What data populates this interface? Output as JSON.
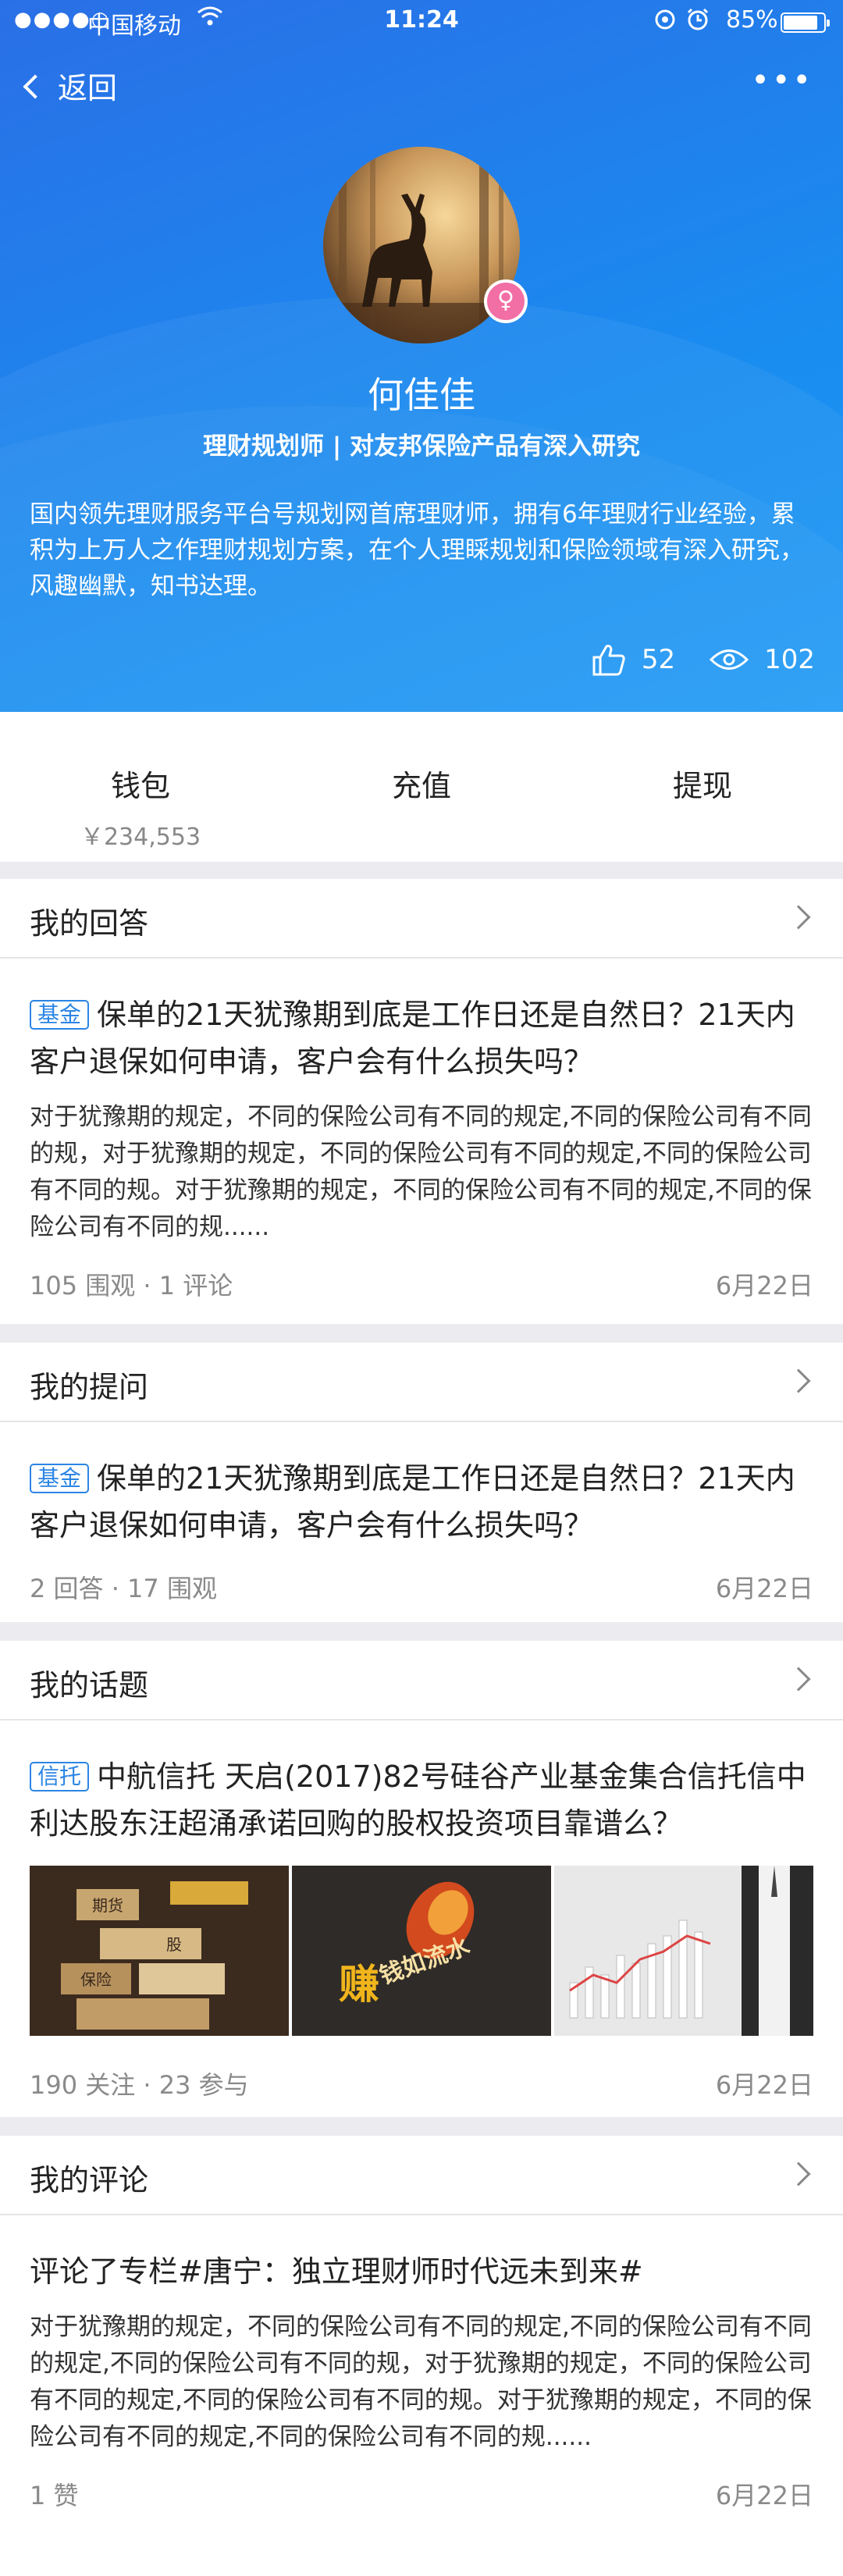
{
  "status_bar": {
    "signal": "●●●●○",
    "carrier": "中国移动",
    "time": "11:24",
    "battery": "85%",
    "battery_level": 0.85
  },
  "nav": {
    "back_label": "返回",
    "more_label": "•••"
  },
  "profile": {
    "name": "何佳佳",
    "gender_icon": "♀",
    "subtitle": "理财规划师 | 对友邦保险产品有深入研究",
    "bio": "国内领先理财服务平台号规划网首席理财师，拥有6年理财行业经验，累积为上万人之作理财规划方案，在个人理睬规划和保险领域有深入研究，风趣幽默，知书达理。",
    "likes": "52",
    "views": "102"
  },
  "wallet": {
    "wallet_label": "钱包",
    "balance": "￥234,553",
    "recharge_label": "充值",
    "withdraw_label": "提现"
  },
  "answers": {
    "title": "我的回答",
    "tag": "基金",
    "question": "保单的21天犹豫期到底是工作日还是自然日？21天内客户退保如何申请，客户会有什么损失吗？",
    "excerpt": "对于犹豫期的规定，不同的保险公司有不同的规定,不同的保险公司有不同的规，对于犹豫期的规定，不同的保险公司有不同的规定,不同的保险公司有不同的规。对于犹豫期的规定，不同的保险公司有不同的规定,不同的保险公司有不同的规......",
    "stats": "105 围观 · 1 评论",
    "date": "6月22日"
  },
  "questions": {
    "title": "我的提问",
    "tag": "基金",
    "question": "保单的21天犹豫期到底是工作日还是自然日？21天内客户退保如何申请，客户会有什么损失吗？",
    "stats": "2 回答 · 17 围观",
    "date": "6月22日"
  },
  "topics": {
    "title": "我的话题",
    "tag": "信托",
    "question": "中航信托 天启(2017)82号硅谷产业基金集合信托信中利达股东汪超涌承诺回购的股权投资项目靠谱么？",
    "images": [
      {
        "name": "futures-blocks-image",
        "labels": [
          "期货",
          "股",
          "保险"
        ]
      },
      {
        "name": "money-flow-image",
        "labels": [
          "赚",
          "钱如流水"
        ]
      },
      {
        "name": "bar-chart-image",
        "labels": []
      }
    ],
    "stats": "190 关注 · 23 参与",
    "date": "6月22日"
  },
  "comments": {
    "title": "我的评论",
    "heading": "评论了专栏#唐宁：独立理财师时代远未到来#",
    "excerpt": "对于犹豫期的规定，不同的保险公司有不同的规定,不同的保险公司有不同的规定,不同的保险公司有不同的规，对于犹豫期的规定，不同的保险公司有不同的规定,不同的保险公司有不同的规。对于犹豫期的规定，不同的保险公司有不同的规定,不同的保险公司有不同的规......",
    "stats": "1 赞",
    "date": "6月22日"
  },
  "colors": {
    "brand_blue": "#1a8cf0",
    "tag_blue": "#2b85e4",
    "gender_pink": "#f26fa5"
  }
}
